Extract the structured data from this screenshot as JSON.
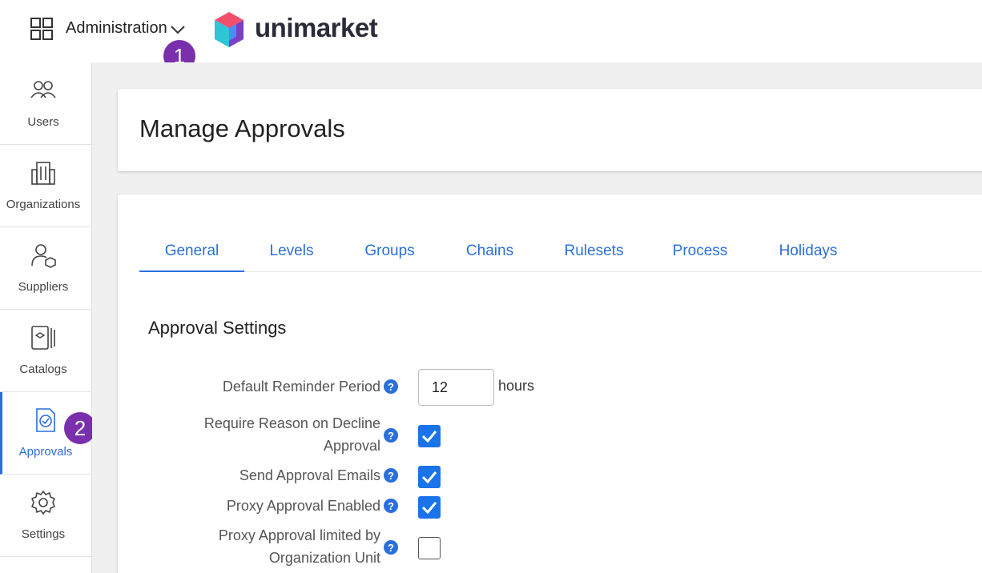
{
  "header": {
    "admin_label": "Administration",
    "logo_text": "unimarket",
    "step_1": "1",
    "step_2": "2"
  },
  "sidebar": {
    "items": [
      {
        "label": "Users",
        "icon": "users-icon"
      },
      {
        "label": "Organizations",
        "icon": "building-icon"
      },
      {
        "label": "Suppliers",
        "icon": "supplier-icon"
      },
      {
        "label": "Catalogs",
        "icon": "catalog-icon"
      },
      {
        "label": "Approvals",
        "icon": "approval-icon",
        "active": true
      },
      {
        "label": "Settings",
        "icon": "gear-icon"
      }
    ]
  },
  "page": {
    "title": "Manage Approvals",
    "tabs": [
      {
        "label": "General",
        "active": true
      },
      {
        "label": "Levels"
      },
      {
        "label": "Groups"
      },
      {
        "label": "Chains"
      },
      {
        "label": "Rulesets"
      },
      {
        "label": "Process"
      },
      {
        "label": "Holidays"
      }
    ],
    "section_title": "Approval Settings"
  },
  "settings": {
    "reminder_label": "Default Reminder Period",
    "reminder_value": "12",
    "reminder_unit": "hours",
    "decline_label_line1": "Require Reason on Decline",
    "decline_label_line2": "Approval",
    "decline_checked": true,
    "emails_label": "Send Approval Emails",
    "emails_checked": true,
    "proxy_label": "Proxy Approval Enabled",
    "proxy_checked": true,
    "proxy_org_label_line1": "Proxy Approval limited by",
    "proxy_org_label_line2": "Organization Unit",
    "proxy_org_checked": false,
    "help_glyph": "?"
  },
  "colors": {
    "accent": "#2a6fdb",
    "checkbox": "#1a73e8",
    "badge": "#7a2fad"
  }
}
